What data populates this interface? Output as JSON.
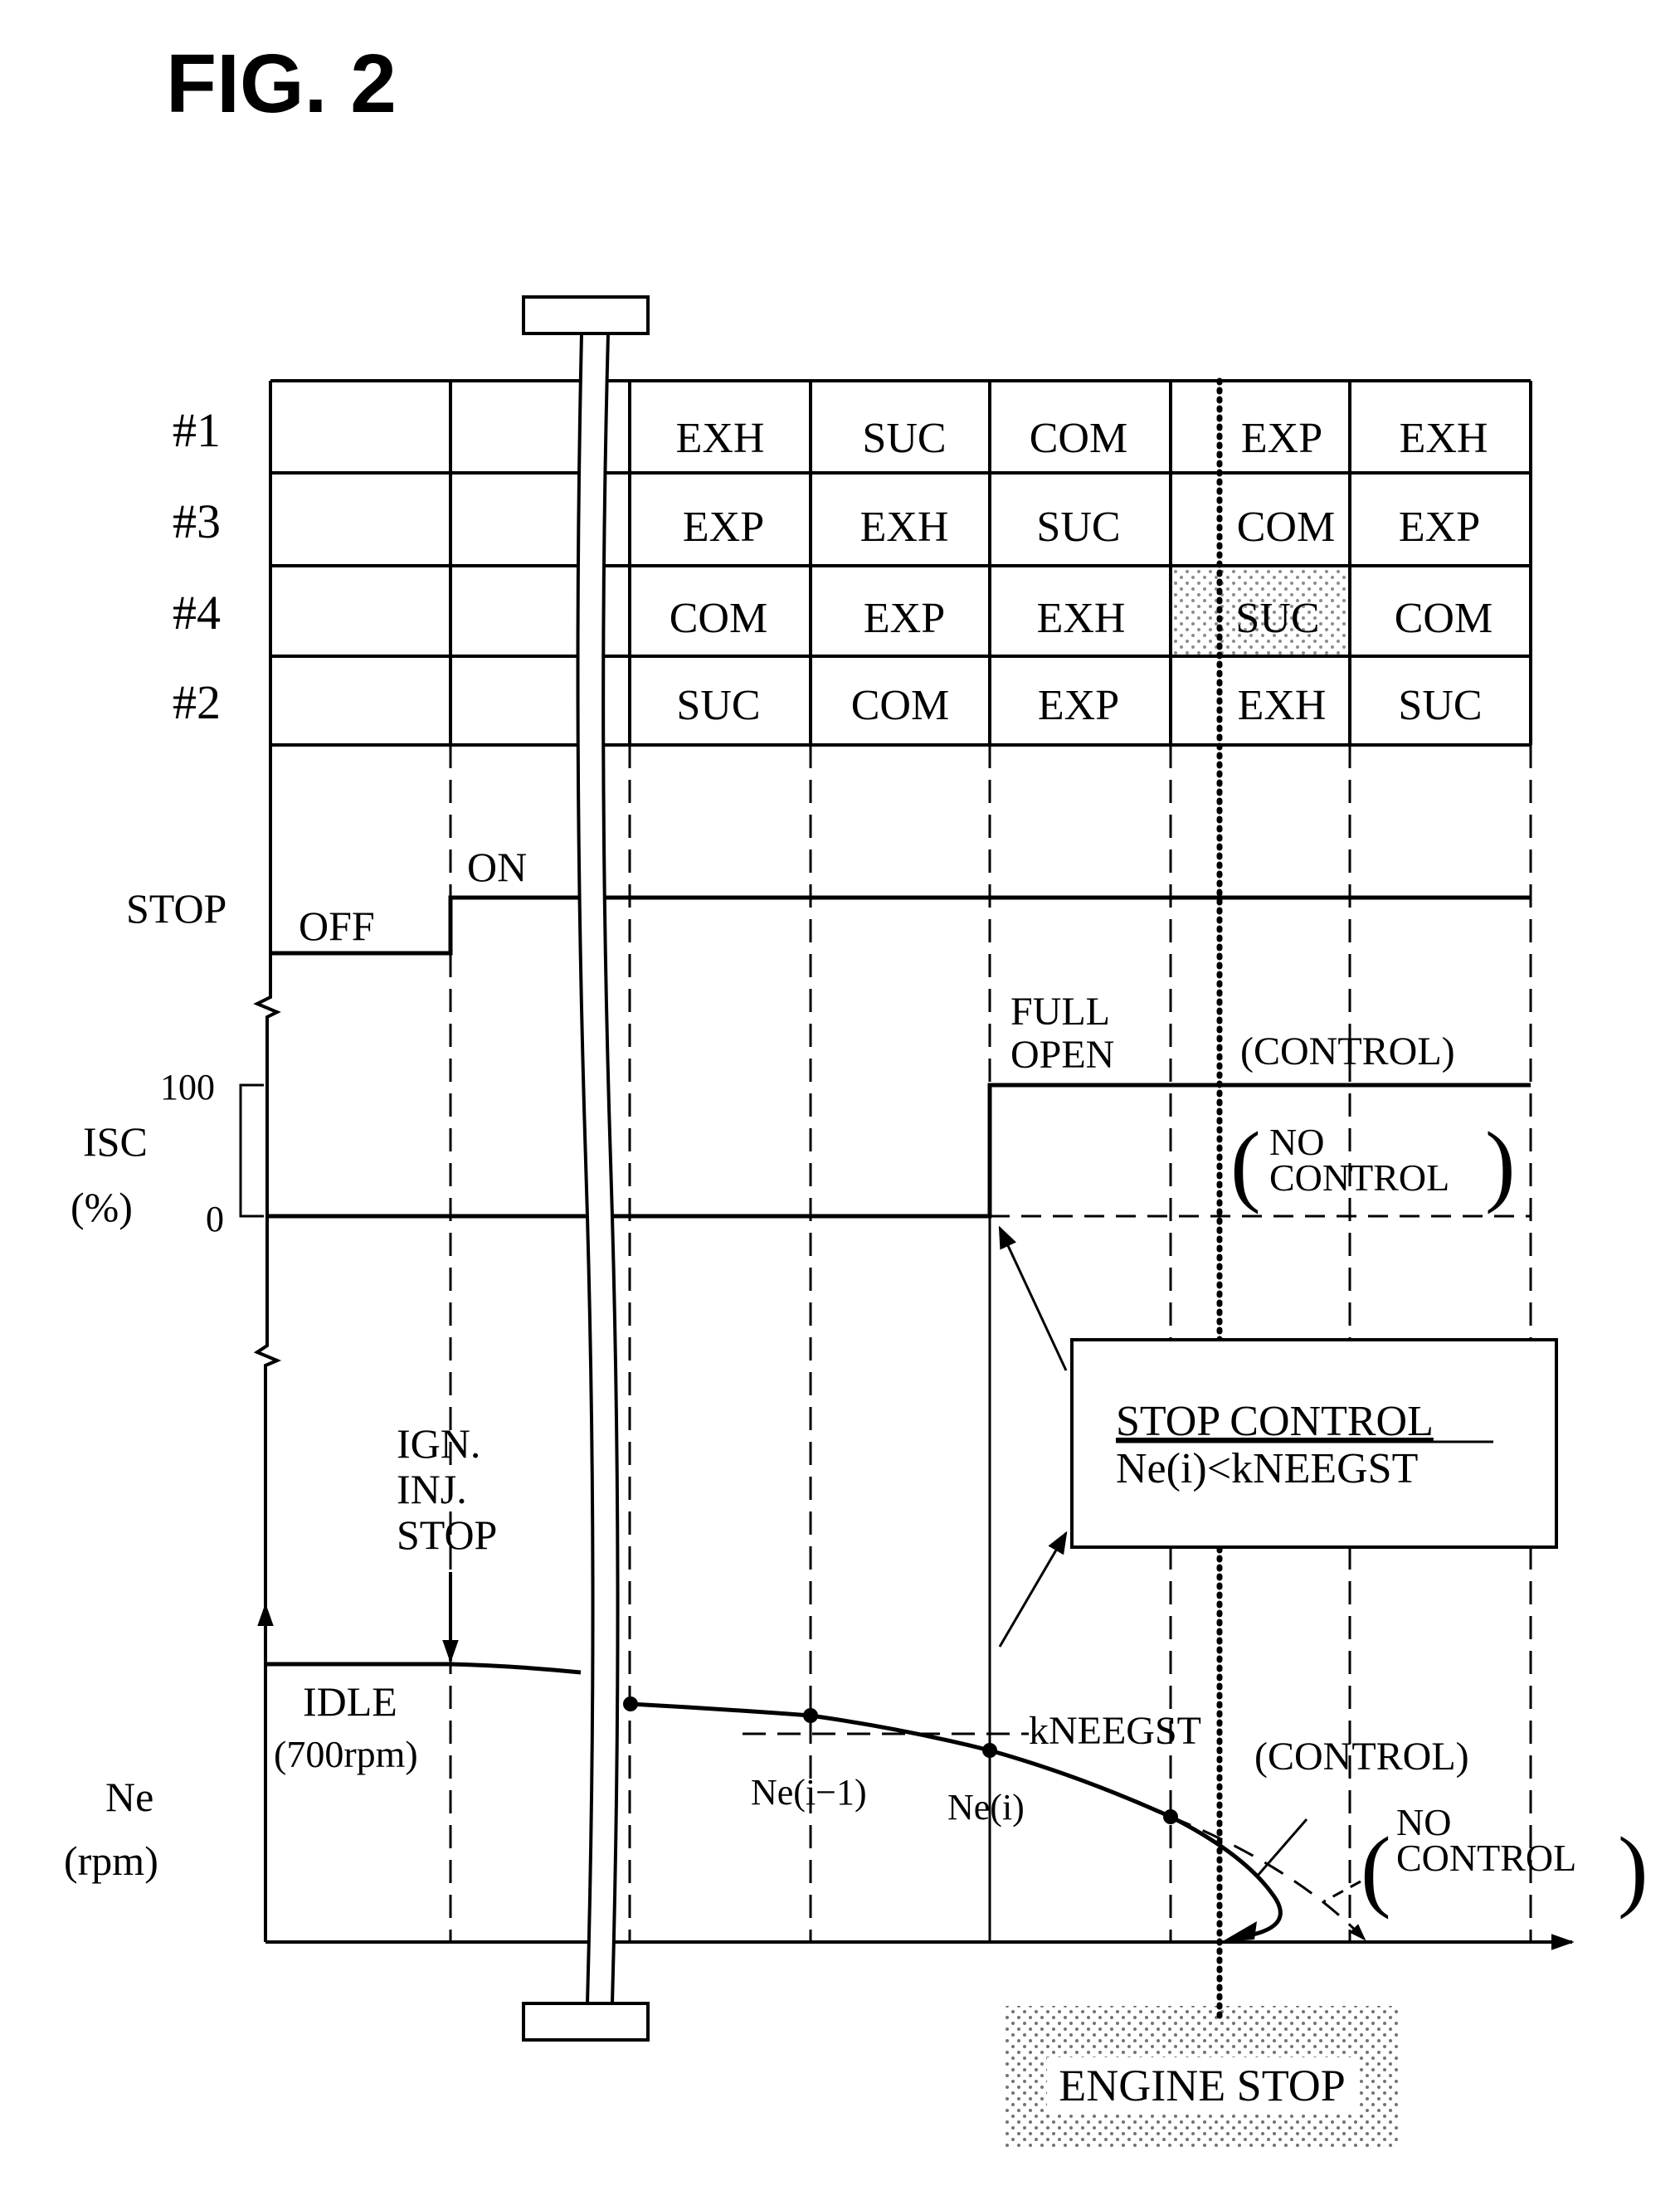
{
  "figure": {
    "title": "FIG. 2"
  },
  "cylinder_table": {
    "rows": [
      {
        "label": "#1",
        "cells": [
          "",
          "",
          "EXH",
          "SUC",
          "COM",
          "EXP",
          "EXH"
        ]
      },
      {
        "label": "#3",
        "cells": [
          "",
          "",
          "EXP",
          "EXH",
          "SUC",
          "COM",
          "EXP"
        ]
      },
      {
        "label": "#4",
        "cells": [
          "",
          "",
          "COM",
          "EXP",
          "EXH",
          "SUC",
          "COM"
        ]
      },
      {
        "label": "#2",
        "cells": [
          "",
          "",
          "SUC",
          "COM",
          "EXP",
          "EXH",
          "SUC"
        ]
      }
    ],
    "highlighted_cell": {
      "row": "#4",
      "value": "SUC"
    }
  },
  "stop_signal": {
    "label": "STOP",
    "off_label": "OFF",
    "on_label": "ON"
  },
  "isc": {
    "label": "ISC",
    "unit": "(%)",
    "tick_100": "100",
    "tick_0": "0",
    "full_open_line1": "FULL",
    "full_open_line2": "OPEN",
    "control_label": "(CONTROL)",
    "no_control_line1": "NO",
    "no_control_line2": "CONTROL"
  },
  "stop_control_box": {
    "title": "STOP CONTROL",
    "condition": "Ne(i)<kNEEGST"
  },
  "ne": {
    "label": "Ne",
    "unit": "(rpm)",
    "event_line1": "IGN.",
    "event_line2": "INJ.",
    "event_line3": "STOP",
    "idle_label": "IDLE",
    "idle_value": "(700rpm)",
    "threshold_label": "kNEEGST",
    "point_prev": "Ne(i−1)",
    "point_curr": "Ne(i)",
    "control_label": "(CONTROL)",
    "no_control_line1": "NO",
    "no_control_line2": "CONTROL"
  },
  "engine_stop": {
    "label": "ENGINE STOP"
  }
}
